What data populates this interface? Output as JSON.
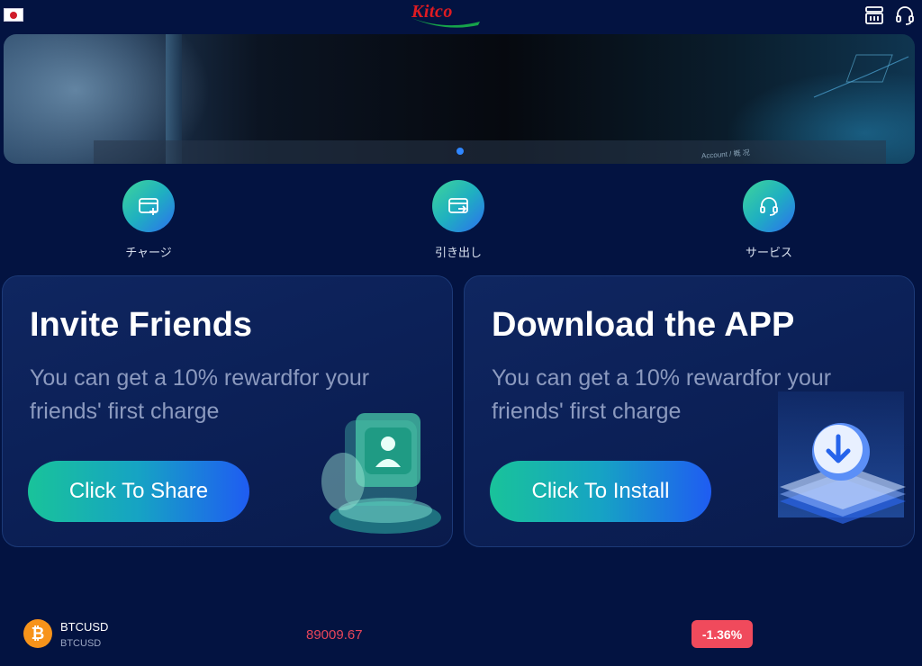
{
  "header": {
    "logo_text": "Kitco",
    "language_flag": "japan-flag",
    "icons": [
      "menu-list-icon",
      "headset-icon"
    ]
  },
  "banner": {
    "carousel_active_index": 1,
    "carousel_count": 1,
    "caption": "Account / 概 况"
  },
  "quick_actions": [
    {
      "label": "チャージ",
      "icon": "card-plus-icon"
    },
    {
      "label": "引き出し",
      "icon": "card-arrow-icon"
    },
    {
      "label": "サービス",
      "icon": "headset-icon"
    }
  ],
  "cards": [
    {
      "title": "Invite Friends",
      "subtitle": "You can get a 10% rewardfor your friends' first charge",
      "button": "Click To Share"
    },
    {
      "title": "Download the APP",
      "subtitle": "You can get a 10% rewardfor your friends' first charge",
      "button": "Click To Install"
    }
  ],
  "ticker": {
    "symbol": "BTCUSD",
    "symbol_sub": "BTCUSD",
    "coin_glyph": "₿",
    "price": "89009.67",
    "change": "-1.36%"
  },
  "colors": {
    "background": "#031341",
    "accent_blue": "#2f86ff",
    "negative": "#f04a5c",
    "bitcoin": "#f7931a"
  }
}
